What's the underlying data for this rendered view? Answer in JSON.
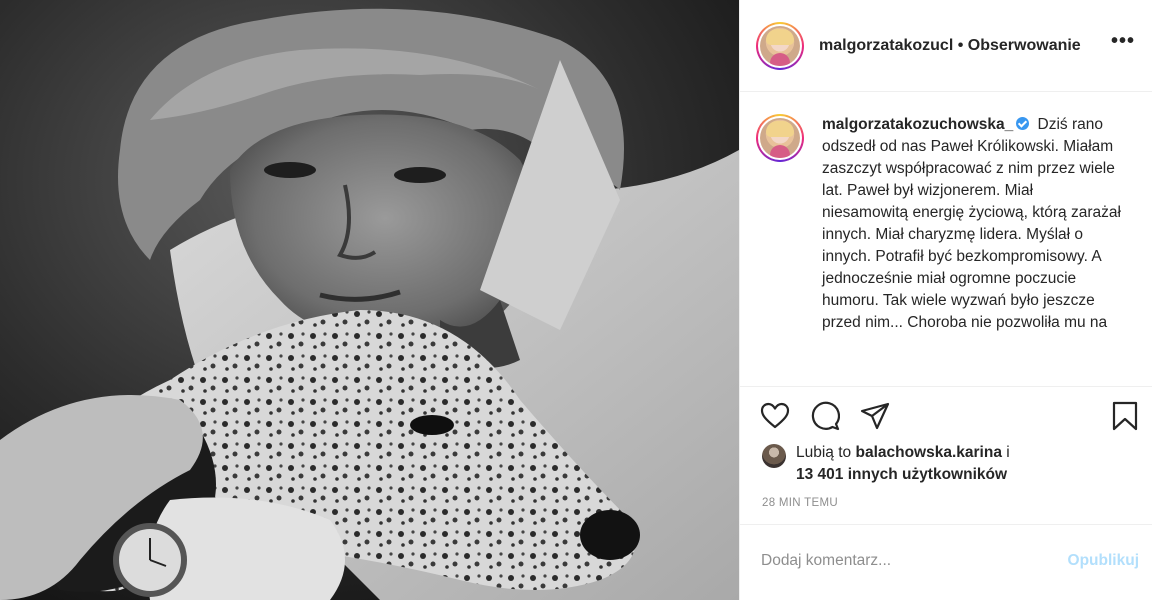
{
  "photo": {
    "alt_icon": "black-and-white-photo-man-with-dog"
  },
  "header": {
    "username": "malgorzatakozucl",
    "separator": "•",
    "follow_label": "Obserwowanie",
    "more_icon": "more-horizontal-icon",
    "more_label": "•••"
  },
  "caption": {
    "username": "malgorzatakozuchowska_",
    "verified_icon": "verified-badge-icon",
    "text": "Dziś rano odszedł od nas Paweł Królikowski. Miałam zaszczyt współpracować z nim przez wiele lat. Paweł był wizjonerem. Miał niesamowitą energię życiową, którą zarażał innych. Miał charyzmę lidera. Myślał o innych. Potrafił być bezkompromisowy. A jednocześnie miał ogromne poczucie humoru. Tak wiele wyzwań było jeszcze przed nim... Choroba nie pozwoliła mu na"
  },
  "actions": {
    "like_icon": "heart-icon",
    "comment_icon": "comment-bubble-icon",
    "share_icon": "paper-plane-icon",
    "save_icon": "bookmark-icon"
  },
  "likes": {
    "prefix": "Lubią to",
    "user": "balachowska.karina",
    "connector": "i",
    "count_text": "13 401 innych użytkowników"
  },
  "timestamp": "28 MIN TEMU",
  "comment": {
    "placeholder": "Dodaj komentarz...",
    "publish_label": "Opublikuj"
  },
  "colors": {
    "link_disabled": "#b2dffc",
    "verified": "#3897f0",
    "muted": "#8e8e8e",
    "text": "#262626",
    "border": "#efefef"
  }
}
